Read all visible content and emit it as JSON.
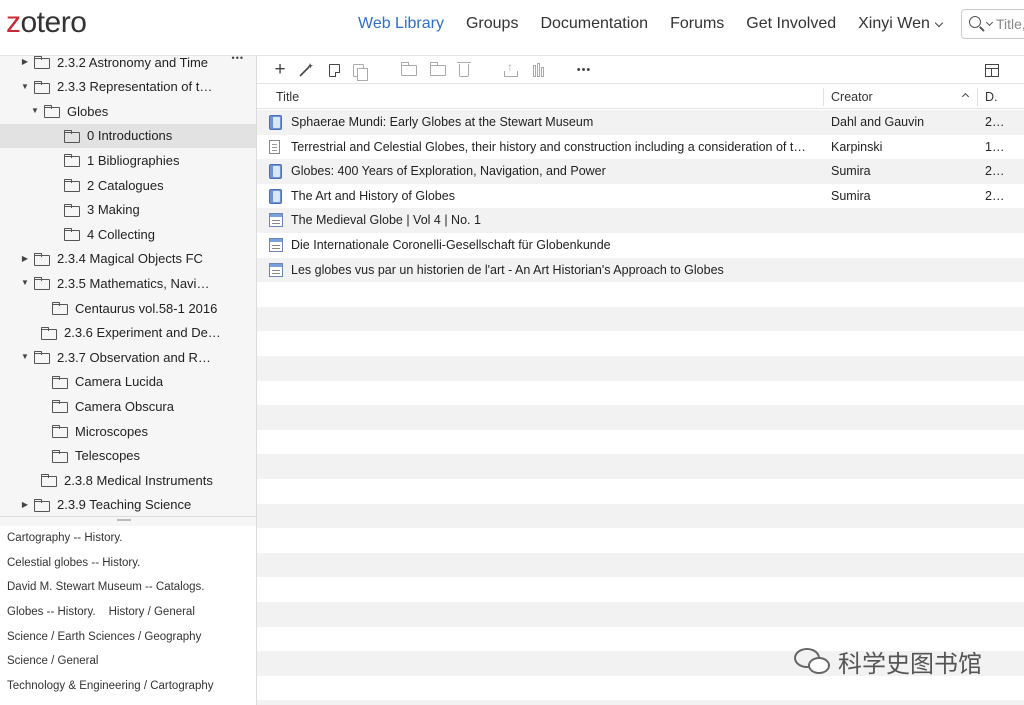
{
  "header": {
    "logo_z": "z",
    "logo_rest": "otero",
    "nav": [
      "Web Library",
      "Groups",
      "Documentation",
      "Forums",
      "Get Involved"
    ],
    "user": "Xinyi Wen",
    "search_placeholder": "Title,"
  },
  "tree": [
    {
      "label": "2.3.2 Astronomy and Time",
      "expanded": false,
      "has_children": true,
      "more": "•••"
    },
    {
      "label": "2.3.3 Representation of t…",
      "expanded": true,
      "has_children": true
    },
    {
      "label": "Globes",
      "expanded": true,
      "has_children": true
    },
    {
      "label": "0 Introductions",
      "selected": true
    },
    {
      "label": "1 Bibliographies"
    },
    {
      "label": "2 Catalogues"
    },
    {
      "label": "3 Making"
    },
    {
      "label": "4 Collecting"
    },
    {
      "label": "2.3.4 Magical Objects FC",
      "has_children": true,
      "expanded": false
    },
    {
      "label": "2.3.5 Mathematics, Navi…",
      "has_children": true,
      "expanded": true
    },
    {
      "label": "Centaurus vol.58-1 2016"
    },
    {
      "label": "2.3.6 Experiment and De…"
    },
    {
      "label": "2.3.7 Observation and R…",
      "has_children": true,
      "expanded": true
    },
    {
      "label": "Camera Lucida"
    },
    {
      "label": "Camera Obscura"
    },
    {
      "label": "Microscopes"
    },
    {
      "label": "Telescopes"
    },
    {
      "label": "2.3.8 Medical Instruments"
    },
    {
      "label": "2.3.9 Teaching Science",
      "has_children": true,
      "expanded": false
    }
  ],
  "tags": [
    [
      "Cartography -- History."
    ],
    [
      "Celestial globes -- History."
    ],
    [
      "David M. Stewart Museum -- Catalogs."
    ],
    [
      "Globes -- History.",
      "History / General"
    ],
    [
      "Science / Earth Sciences / Geography"
    ],
    [
      "Science / General"
    ],
    [
      "Technology & Engineering / Cartography"
    ]
  ],
  "toolbar": {
    "add": "+",
    "wand": "⁄",
    "more": "•••"
  },
  "columns": {
    "title": "Title",
    "creator": "Creator",
    "date": "D."
  },
  "items": [
    {
      "type": "book",
      "title": "Sphaerae Mundi: Early Globes at the Stewart Museum",
      "creator": "Dahl and Gauvin",
      "date": "2…"
    },
    {
      "type": "document",
      "title": "Terrestrial and Celestial Globes, their history and construction including a consideration of their value as aids in the study of geography and astronomy",
      "creator": "Karpinski",
      "date": "1…"
    },
    {
      "type": "book",
      "title": "Globes: 400 Years of Exploration, Navigation, and Power",
      "creator": "Sumira",
      "date": "2…"
    },
    {
      "type": "book",
      "title": "The Art and History of Globes",
      "creator": "Sumira",
      "date": "2…"
    },
    {
      "type": "magazine",
      "title": "The Medieval Globe | Vol 4 | No. 1",
      "creator": "",
      "date": ""
    },
    {
      "type": "magazine",
      "title": "Die Internationale Coronelli-Gesellschaft für Globenkunde",
      "creator": "",
      "date": ""
    },
    {
      "type": "magazine",
      "title": "Les globes vus par un historien de l'art - An Art Historian's Approach to Globes",
      "creator": "",
      "date": ""
    }
  ],
  "watermark": "科学史图书馆"
}
